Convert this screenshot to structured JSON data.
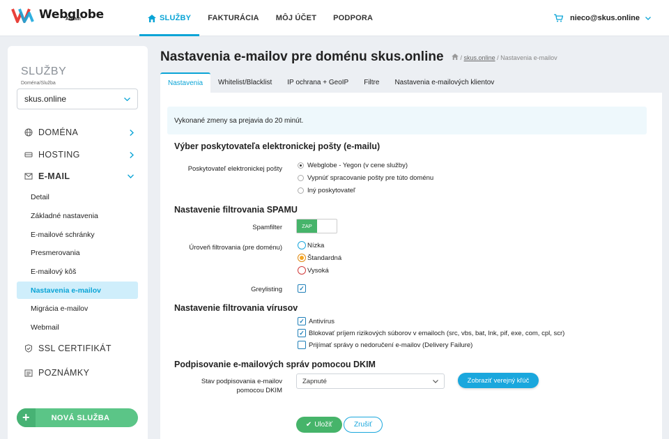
{
  "brand": {
    "name": "Webglobe",
    "sub": "Admin"
  },
  "nav": [
    {
      "label": "SLUŽBY",
      "active": true
    },
    {
      "label": "FAKTURÁCIA"
    },
    {
      "label": "MÔJ ÚČET"
    },
    {
      "label": "PODPORA"
    }
  ],
  "user": {
    "email": "nieco@skus.online"
  },
  "sidebar": {
    "title": "SLUŽBY",
    "subtitle": "Doména/Služba",
    "selected_domain": "skus.online",
    "items": [
      {
        "label": "DOMÉNA",
        "icon": "globe-icon"
      },
      {
        "label": "HOSTING",
        "icon": "server-icon"
      },
      {
        "label": "E-MAIL",
        "icon": "envelope-icon"
      },
      {
        "label": "SSL CERTIFIKÁT",
        "icon": "shield-icon"
      },
      {
        "label": "POZNÁMKY",
        "icon": "notes-icon"
      }
    ],
    "email_sub": [
      "Detail",
      "Základné nastavenia",
      "E-mailové schránky",
      "Presmerovania",
      "E-mailový kôš",
      "Nastavenia e-mailov",
      "Migrácia e-mailov",
      "Webmail"
    ],
    "new_service": "NOVÁ SLUŽBA"
  },
  "page": {
    "title": "Nastavenia e-mailov pre doménu skus.online",
    "breadcrumb": {
      "sep1": "/",
      "link": "skus.online",
      "sep2": "/",
      "current": "Nastavenia e-mailov"
    }
  },
  "tabs": [
    "Nastavenia",
    "Whitelist/Blacklist",
    "IP ochrana + GeoIP",
    "Filtre",
    "Nastavenia e-mailových klientov"
  ],
  "info": "Vykonané zmeny sa prejavia do 20 minút.",
  "provider": {
    "heading": "Výber poskytovateľa elektronickej pošty (e-mailu)",
    "label": "Poskytovateľ elektronickej pošty",
    "options": [
      "Webglobe - Yegon (v cene služby)",
      "Vypnúť spracovanie pošty pre túto doménu",
      "Iný poskytovateľ"
    ],
    "selected": 0
  },
  "spam": {
    "heading": "Nastavenie filtrovania SPAMU",
    "filter_label": "Spamfilter",
    "toggle_label": "ZAP",
    "level_label": "Úroveň filtrovania (pre doménu)",
    "levels": [
      "Nízka",
      "Štandardná",
      "Vysoká"
    ],
    "greylisting_label": "Greylisting"
  },
  "virus": {
    "heading": "Nastavenie filtrovania vírusov",
    "options": [
      "Antivírus",
      "Blokovať príjem rizikových súborov v emailoch (src, vbs, bat, lnk, pif, exe, com, cpl, scr)",
      "Prijímať správy o nedoručení e-mailov (Delivery Failure)"
    ]
  },
  "dkim": {
    "heading": "Podpisovanie e-mailových správ pomocou DKIM",
    "label_line1": "Stav podpisovania e-mailov",
    "label_line2": "pomocou DKIM",
    "value": "Zapnuté",
    "key_button": "Zobraziť verejný kľúč"
  },
  "actions": {
    "save": "Uložiť",
    "cancel": "Zrušiť"
  },
  "colors": {
    "accent": "#0aa4d6",
    "green": "#46b46a"
  }
}
